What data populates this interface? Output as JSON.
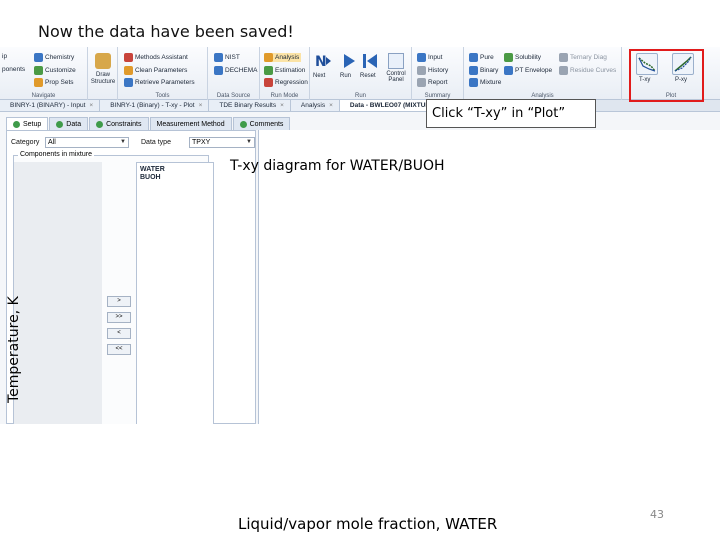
{
  "slide": {
    "title": "Now the data have been saved!",
    "callout": "Click “T-xy” in “Plot”",
    "chart_title": "T-xy diagram for WATER/BUOH",
    "y_axis_label": "Temperature, K",
    "x_axis_label": "Liquid/vapor mole fraction, WATER",
    "page_number": "43"
  },
  "ribbon": {
    "navigate": {
      "label": "Navigate",
      "items": [
        "ip",
        "ponents",
        "Chemistry",
        "Customize",
        "Prop Sets"
      ]
    },
    "units_label": "Draw Structure",
    "tools": {
      "label": "Tools",
      "items": [
        "Methods Assistant",
        "Clean Parameters",
        "Retrieve Parameters"
      ]
    },
    "data_source": {
      "label": "Data Source",
      "items": [
        "NIST",
        "DECHEMA"
      ]
    },
    "run_mode": {
      "label": "Run Mode",
      "items": [
        "Analysis",
        "Estimation",
        "Regression"
      ]
    },
    "run": {
      "label": "Run",
      "items": [
        "Next",
        "Run",
        "Reset",
        "Control Panel"
      ]
    },
    "summary": {
      "label": "Summary",
      "items": [
        "Input",
        "History",
        "Report"
      ]
    },
    "analysis": {
      "label": "Analysis",
      "items": [
        "Pure",
        "Binary",
        "Mixture",
        "Solubility",
        "PT Envelope",
        "Ternary Diag",
        "Residue Curves"
      ]
    },
    "plot": {
      "label": "Plot",
      "items": [
        "T-xy",
        "P-xy"
      ]
    }
  },
  "doc_tabs": [
    "BINRY-1 (BINARY) - Input",
    "BINRY-1 (Binary) - T-xy - Plot",
    "TDE Binary Results",
    "Analysis",
    "Data - BWLEO07 (MIXTURE)"
  ],
  "sub_tabs": [
    "Setup",
    "Data",
    "Constraints",
    "Measurement Method",
    "Comments"
  ],
  "form": {
    "category_label": "Category",
    "category_value": "All",
    "data_type_label": "Data type",
    "data_type_value": "TPXY",
    "mixture_title": "Components in mixture",
    "components": [
      "WATER",
      "BUOH"
    ],
    "move_buttons": [
      ">",
      ">>",
      "<",
      "<<"
    ]
  }
}
